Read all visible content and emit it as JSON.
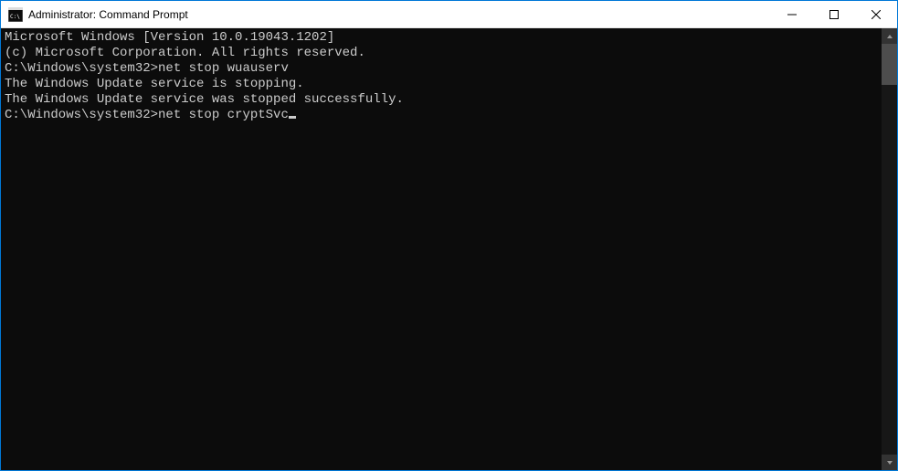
{
  "titlebar": {
    "title": "Administrator: Command Prompt"
  },
  "terminal": {
    "lines": [
      "Microsoft Windows [Version 10.0.19043.1202]",
      "(c) Microsoft Corporation. All rights reserved.",
      "",
      "C:\\Windows\\system32>net stop wuauserv",
      "The Windows Update service is stopping.",
      "The Windows Update service was stopped successfully.",
      "",
      "",
      "C:\\Windows\\system32>net stop cryptSvc"
    ],
    "prompt": "C:\\Windows\\system32>",
    "commands": [
      "net stop wuauserv",
      "net stop cryptSvc"
    ]
  }
}
